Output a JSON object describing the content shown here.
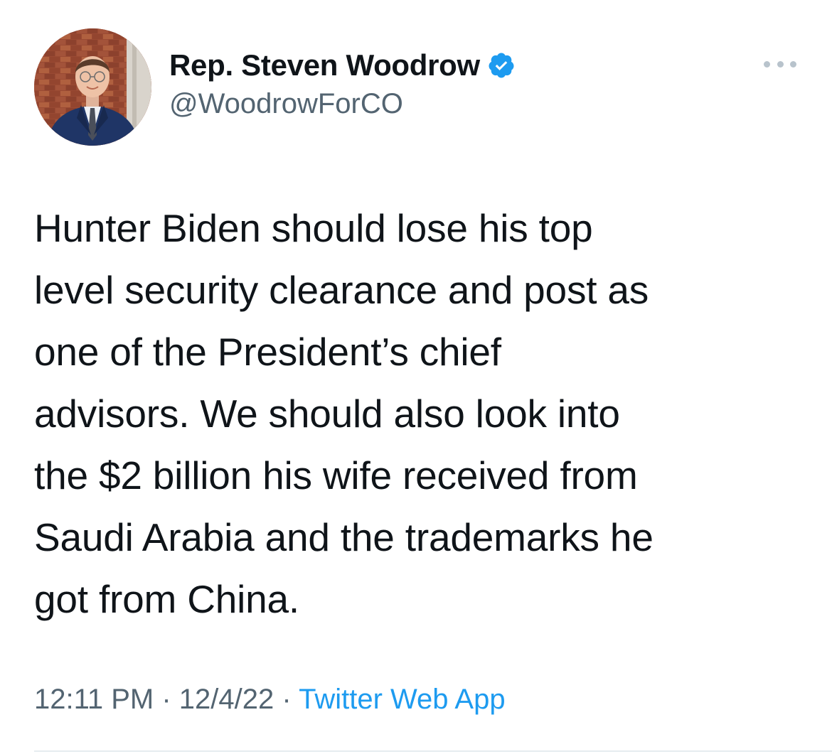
{
  "author": {
    "display_name": "Rep. Steven Woodrow",
    "handle": "@WoodrowForCO",
    "verified": true,
    "avatar_icon": "profile-photo"
  },
  "tweet": {
    "text": "Hunter Biden should lose his top\nlevel security clearance and post as\none of the President’s chief\nadvisors. We should also look into\nthe $2 billion his wife received from\nSaudi Arabia and the trademarks he\ngot from China."
  },
  "meta": {
    "time": "12:11 PM",
    "separator": " · ",
    "date": "12/4/22",
    "source": "Twitter Web App"
  },
  "icons": {
    "verified": "verified-badge-icon",
    "more": "more-options-icon"
  },
  "colors": {
    "text": "#0f1419",
    "secondary": "#536471",
    "link": "#1d9bf0",
    "verified": "#1d9bf0"
  }
}
